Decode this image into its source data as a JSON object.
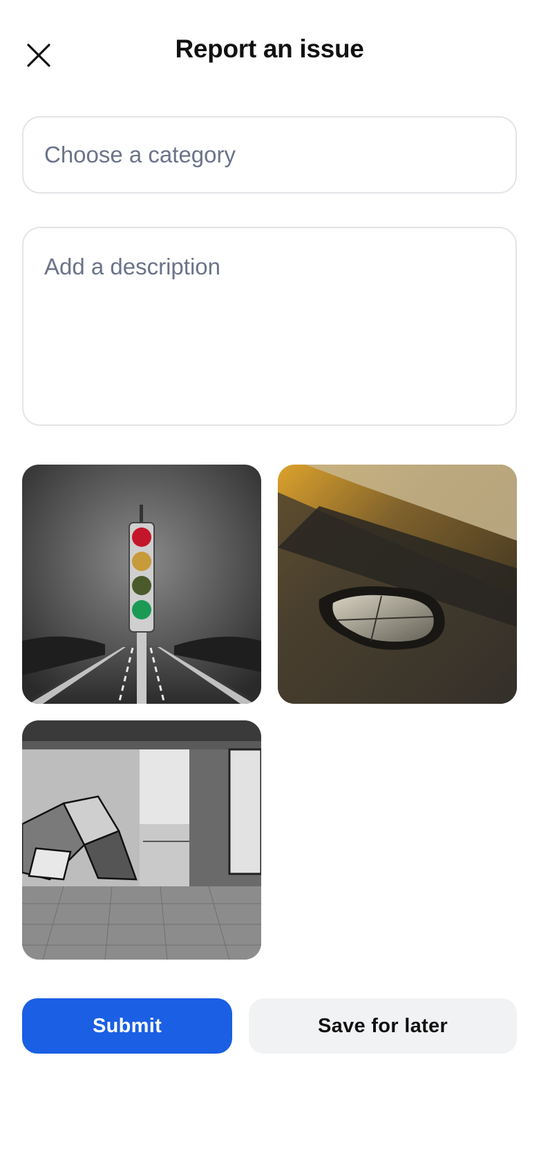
{
  "header": {
    "title": "Report an issue",
    "close_icon": "close-icon"
  },
  "form": {
    "category_placeholder": "Choose a category",
    "description_placeholder": "Add a description"
  },
  "photos": [
    {
      "subject": "traffic light over road"
    },
    {
      "subject": "pothole with puddle on road"
    },
    {
      "subject": "graffiti in empty building"
    }
  ],
  "actions": {
    "submit_label": "Submit",
    "save_label": "Save for later"
  },
  "colors": {
    "primary": "#1a5fe4",
    "secondary_bg": "#f1f2f4",
    "placeholder": "#6b7389",
    "border": "#e2e4e8"
  }
}
